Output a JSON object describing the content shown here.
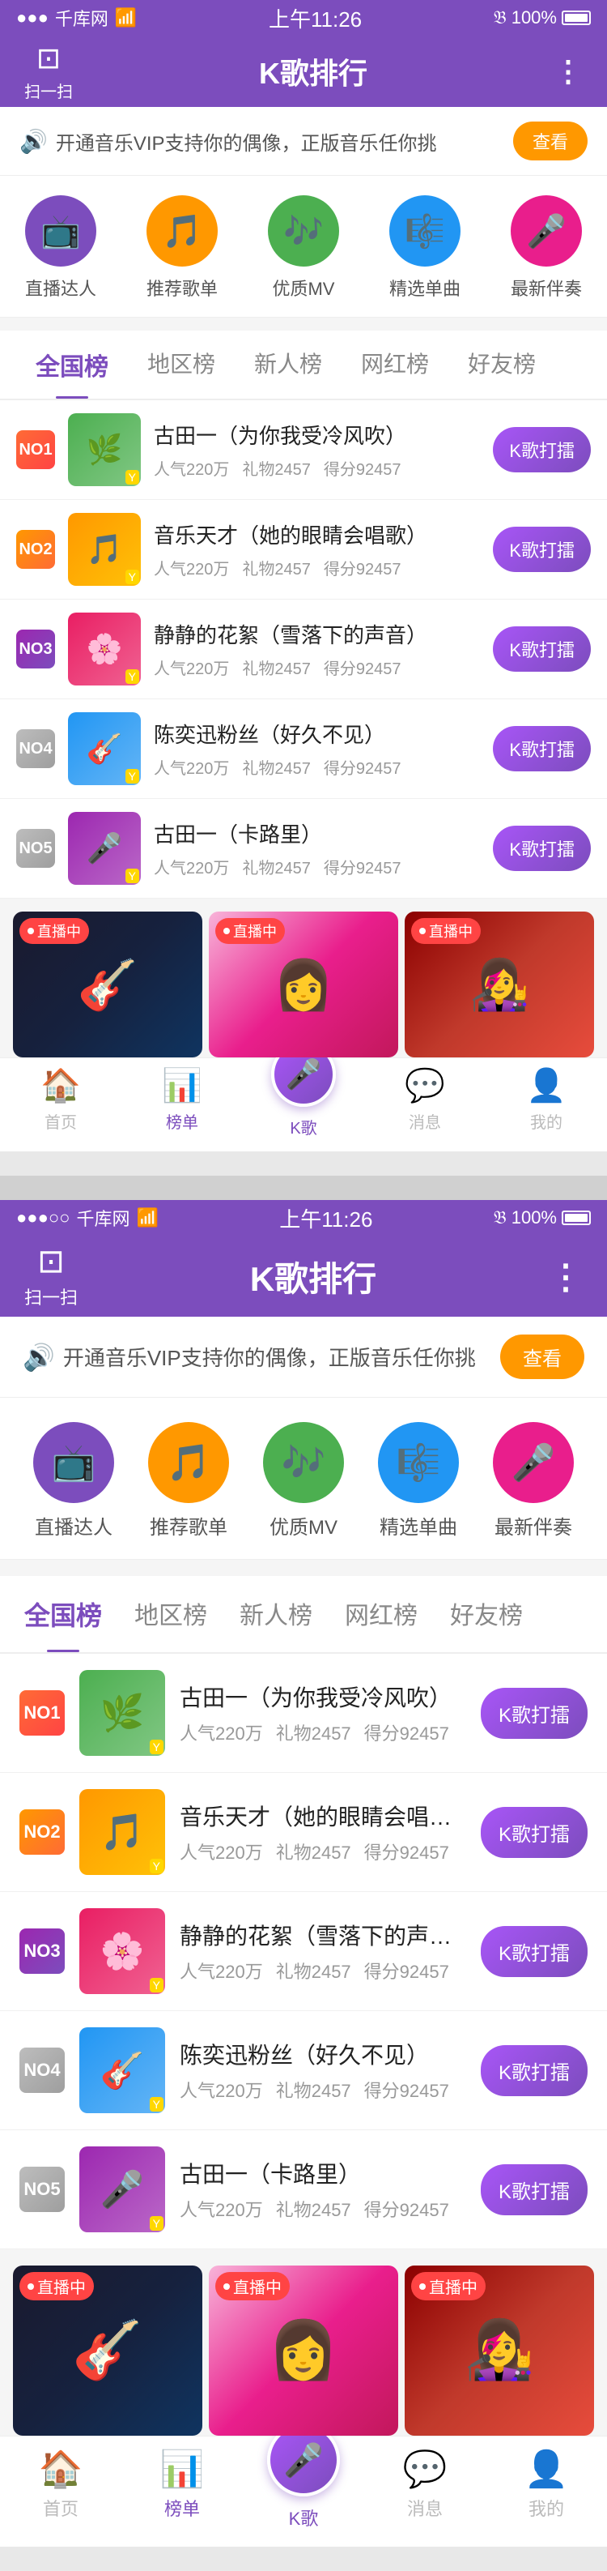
{
  "app": {
    "title": "K歌排行"
  },
  "statusBar": {
    "carrier": "千库网",
    "time": "上午11:26",
    "battery": "100%"
  },
  "header": {
    "scan": "扫一扫",
    "title": "K歌排行",
    "more": "⋮"
  },
  "banner": {
    "text": "开通音乐VIP支持你的偶像，正版音乐任你挑",
    "buttonLabel": "查看"
  },
  "categories": [
    {
      "icon": "📺",
      "label": "直播达人",
      "colorClass": "cat-purple"
    },
    {
      "icon": "🎵",
      "label": "推荐歌单",
      "colorClass": "cat-orange"
    },
    {
      "icon": "🎶",
      "label": "优质MV",
      "colorClass": "cat-green"
    },
    {
      "icon": "🎼",
      "label": "精选单曲",
      "colorClass": "cat-blue"
    },
    {
      "icon": "🎤",
      "label": "最新伴奏",
      "colorClass": "cat-pink"
    }
  ],
  "tabs": [
    {
      "label": "全国榜",
      "active": true
    },
    {
      "label": "地区榜",
      "active": false
    },
    {
      "label": "新人榜",
      "active": false
    },
    {
      "label": "网红榜",
      "active": false
    },
    {
      "label": "好友榜",
      "active": false
    }
  ],
  "songs": [
    {
      "rank": "NO1",
      "rankClass": "rank-1",
      "coverClass": "cover-1",
      "title": "古田一（为你我受冷风吹）",
      "popularity": "人气220万",
      "gifts": "礼物2457",
      "score": "得分92457",
      "btnLabel": "K歌打擂"
    },
    {
      "rank": "NO2",
      "rankClass": "rank-2",
      "coverClass": "cover-2",
      "title": "音乐天才（她的眼睛会唱歌）",
      "popularity": "人气220万",
      "gifts": "礼物2457",
      "score": "得分92457",
      "btnLabel": "K歌打擂"
    },
    {
      "rank": "NO3",
      "rankClass": "rank-3",
      "coverClass": "cover-3",
      "title": "静静的花絮（雪落下的声音）",
      "popularity": "人气220万",
      "gifts": "礼物2457",
      "score": "得分92457",
      "btnLabel": "K歌打擂"
    },
    {
      "rank": "NO4",
      "rankClass": "rank-other",
      "coverClass": "cover-4",
      "title": "陈奕迅粉丝（好久不见）",
      "popularity": "人气220万",
      "gifts": "礼物2457",
      "score": "得分92457",
      "btnLabel": "K歌打擂"
    },
    {
      "rank": "NO5",
      "rankClass": "rank-other",
      "coverClass": "cover-5",
      "title": "古田一（卡路里）",
      "popularity": "人气220万",
      "gifts": "礼物2457",
      "score": "得分92457",
      "btnLabel": "K歌打擂"
    }
  ],
  "liveCards": [
    {
      "bgClass": "live-bg-1",
      "tag": "直播中",
      "emoji": "🎸"
    },
    {
      "bgClass": "live-bg-2",
      "tag": "直播中",
      "emoji": "👩"
    },
    {
      "bgClass": "live-bg-3",
      "tag": "直播中",
      "emoji": "👩‍🎤"
    }
  ],
  "bottomNav": [
    {
      "icon": "🏠",
      "label": "首页",
      "active": false
    },
    {
      "icon": "📊",
      "label": "榜单",
      "active": true
    },
    {
      "icon": "🎤",
      "label": "K歌",
      "active": false,
      "center": true
    },
    {
      "icon": "💬",
      "label": "消息",
      "active": false
    },
    {
      "icon": "👤",
      "label": "我的",
      "active": false
    }
  ]
}
